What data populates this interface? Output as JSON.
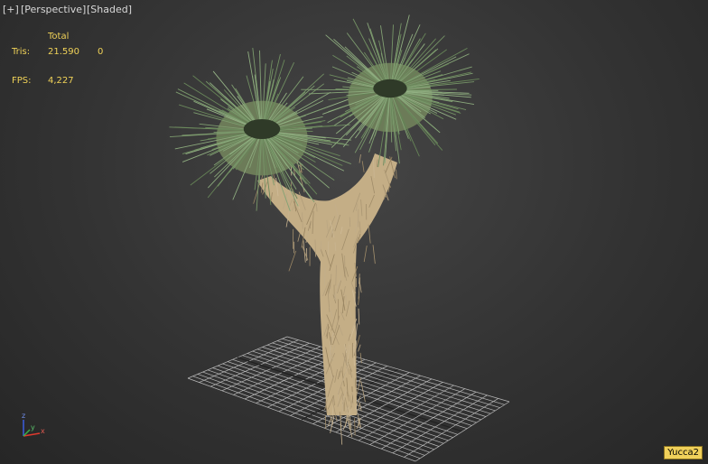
{
  "viewport": {
    "plus_label": "[+]",
    "view_label": "[Perspective]",
    "shading_label": "[Shaded]"
  },
  "stats": {
    "header": "Total",
    "tris_label": "Tris:",
    "tris_value": "21.590",
    "tris_selected": "0",
    "fps_label": "FPS:",
    "fps_value": "4,227"
  },
  "gizmo": {
    "x": "x",
    "y": "y",
    "z": "z"
  },
  "object_name": "Yucca2",
  "colors": {
    "stats_text": "#f0d258",
    "label_text": "#d8d8d8",
    "grid": "#b9b9b9",
    "trunk": "#c4ae86",
    "foliage": "#7d8e68",
    "tag_bg": "#f0d05a",
    "axis_x": "#e03a2e",
    "axis_y": "#38b04a",
    "axis_z": "#3a5ee0"
  }
}
